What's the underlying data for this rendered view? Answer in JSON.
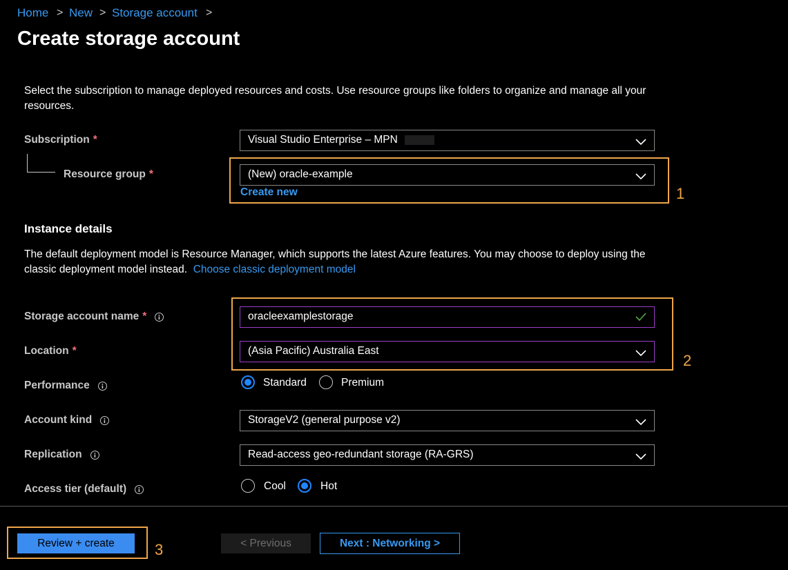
{
  "breadcrumb": {
    "items": [
      "Home",
      "New",
      "Storage account"
    ],
    "separator": ">"
  },
  "page_title": "Create storage account",
  "intro_text": "Select the subscription to manage deployed resources and costs. Use resource groups like folders to organize and manage all your resources.",
  "subscription": {
    "label": "Subscription",
    "required_mark": "*",
    "value": "Visual Studio Enterprise – MPN"
  },
  "resource_group": {
    "label": "Resource group",
    "required_mark": "*",
    "value": "(New) oracle-example",
    "create_new": "Create new"
  },
  "instance_details": {
    "heading": "Instance details",
    "description": "The default deployment model is Resource Manager, which supports the latest Azure features. You may choose to deploy using the classic deployment model instead.",
    "classic_link": "Choose classic deployment model"
  },
  "storage_account_name": {
    "label": "Storage account name",
    "required_mark": "*",
    "value": "oracleexamplestorage"
  },
  "location": {
    "label": "Location",
    "required_mark": "*",
    "value": "(Asia Pacific) Australia East"
  },
  "performance": {
    "label": "Performance",
    "options": [
      "Standard",
      "Premium"
    ],
    "selected": "Standard"
  },
  "account_kind": {
    "label": "Account kind",
    "value": "StorageV2 (general purpose v2)"
  },
  "replication": {
    "label": "Replication",
    "value": "Read-access geo-redundant storage (RA-GRS)"
  },
  "access_tier": {
    "label": "Access tier (default)",
    "options": [
      "Cool",
      "Hot"
    ],
    "selected": "Hot"
  },
  "footer": {
    "review_create": "Review + create",
    "previous": "< Previous",
    "next": "Next : Networking >"
  },
  "callouts": [
    "1",
    "2",
    "3"
  ],
  "icons": {
    "chevron": "chevron-down-icon",
    "info": "info-icon",
    "check": "check-icon"
  },
  "colors": {
    "accent": "#3899f0",
    "primary_button": "#3b8cf0",
    "highlight": "#f0a64a",
    "required": "#f1707b",
    "valid_check": "#57a64a",
    "field_focus_border": "#9c3fc8"
  }
}
